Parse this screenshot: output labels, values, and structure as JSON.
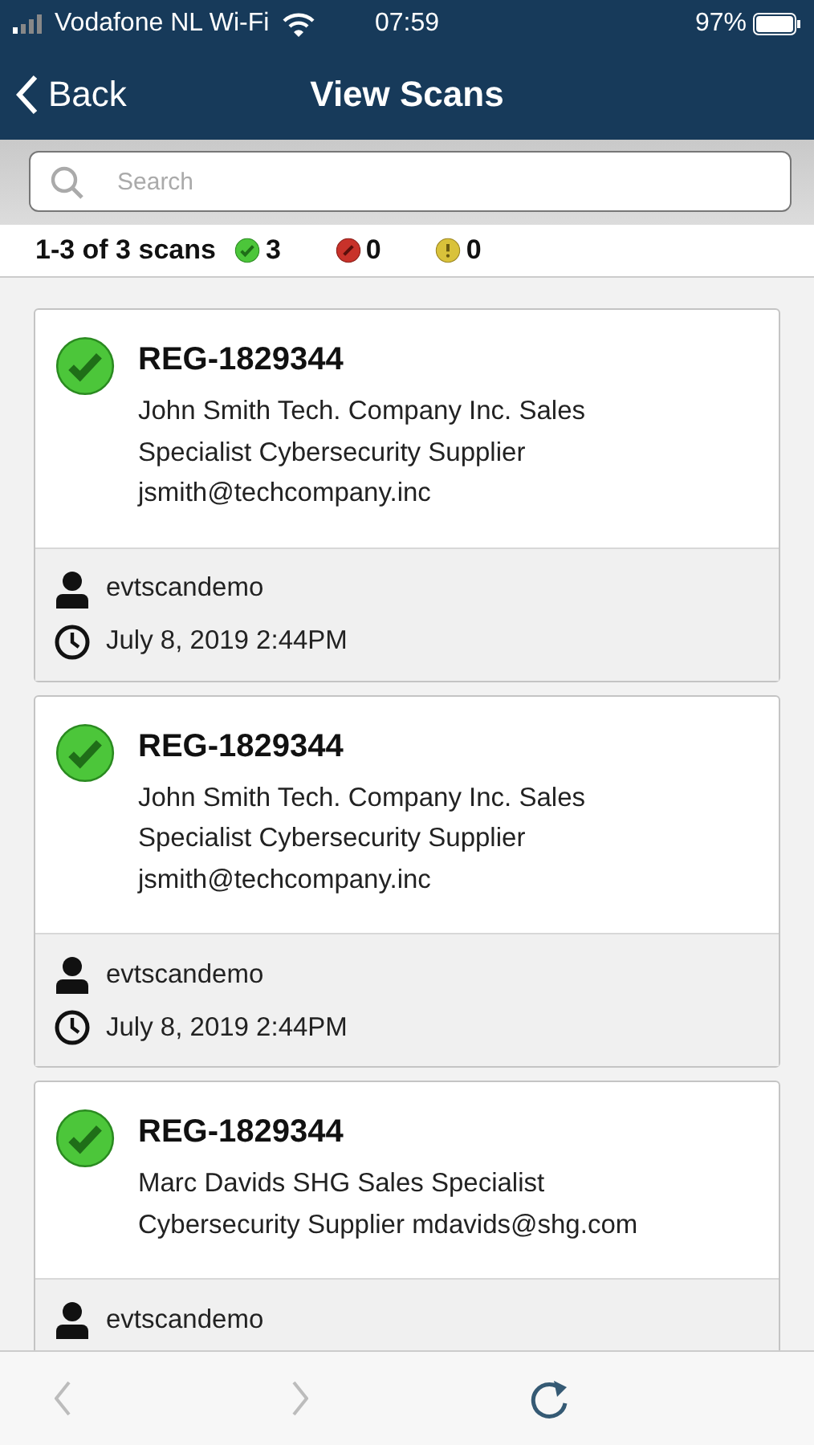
{
  "status_bar": {
    "carrier": "Vodafone NL Wi-Fi",
    "time": "07:59",
    "battery": "97%"
  },
  "nav": {
    "back": "Back",
    "title": "View Scans"
  },
  "search": {
    "placeholder": "Search"
  },
  "summary": {
    "range": "1-3 of 3 scans",
    "counts": [
      {
        "kind": "ok",
        "count": "3"
      },
      {
        "kind": "error",
        "count": "0"
      },
      {
        "kind": "warning",
        "count": "0"
      }
    ]
  },
  "scans": [
    {
      "kind": "ok",
      "id": "REG-1829344",
      "details": "John Smith Tech. Company Inc. Sales Specialist Cybersecurity Supplier jsmith@techcompany.inc",
      "user": "evtscandemo",
      "date": "July 8, 2019 2:44PM"
    },
    {
      "kind": "ok",
      "id": "REG-1829344",
      "details": "John Smith Tech. Company Inc. Sales Specialist Cybersecurity Supplier jsmith@techcompany.inc",
      "user": "evtscandemo",
      "date": "July 8, 2019 2:44PM"
    },
    {
      "kind": "ok",
      "id": "REG-1829344",
      "details": "Marc Davids SHG Sales Specialist Cybersecurity Supplier mdavids@shg.com",
      "user": "evtscandemo"
    }
  ],
  "toolbar": {
    "previous": {
      "disabled": true
    },
    "next": {
      "disabled": true
    },
    "refresh": {
      "disabled": false
    }
  }
}
